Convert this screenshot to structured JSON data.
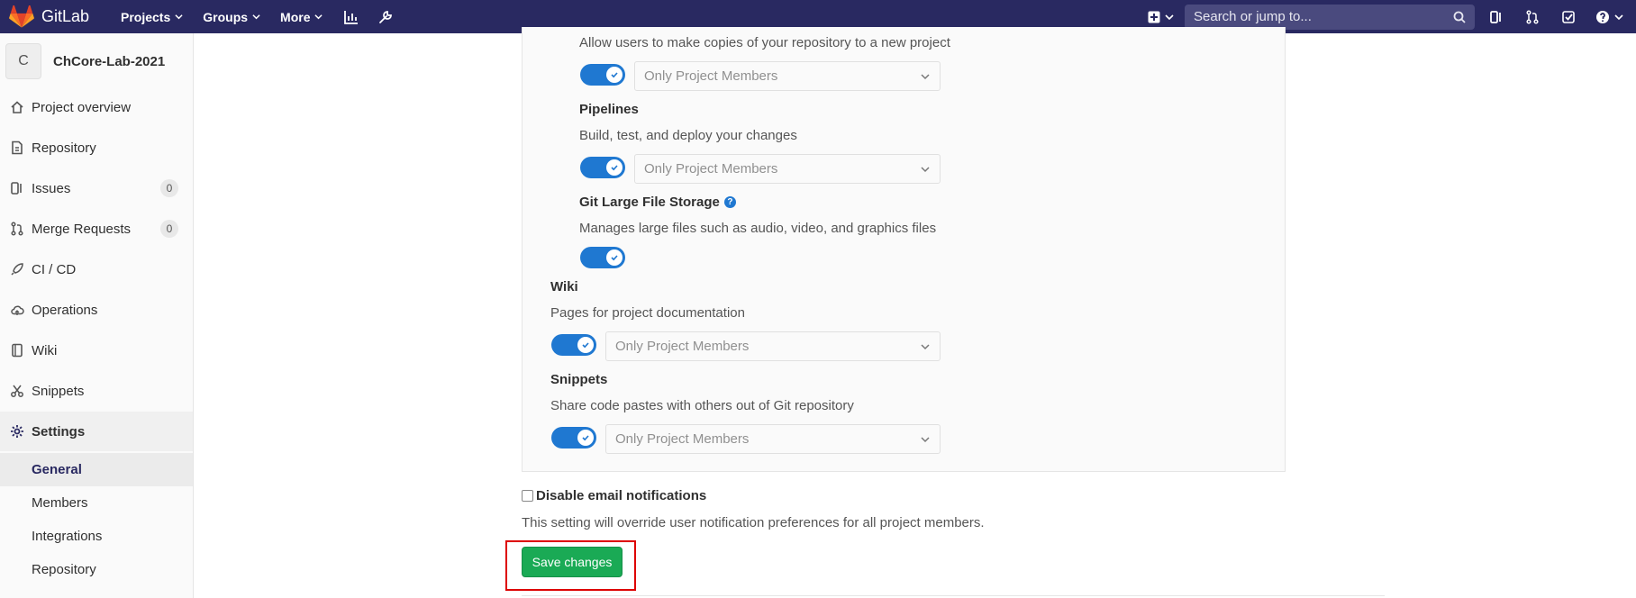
{
  "navbar": {
    "brand": "GitLab",
    "menu": [
      "Projects",
      "Groups",
      "More"
    ],
    "search_placeholder": "Search or jump to..."
  },
  "sidebar": {
    "project_initial": "C",
    "project_name": "ChCore-Lab-2021",
    "items": [
      {
        "label": "Project overview",
        "icon": "home-icon"
      },
      {
        "label": "Repository",
        "icon": "doc-icon"
      },
      {
        "label": "Issues",
        "icon": "issues-icon",
        "badge": "0"
      },
      {
        "label": "Merge Requests",
        "icon": "merge-request-icon",
        "badge": "0"
      },
      {
        "label": "CI / CD",
        "icon": "rocket-icon"
      },
      {
        "label": "Operations",
        "icon": "cloud-icon"
      },
      {
        "label": "Wiki",
        "icon": "book-icon"
      },
      {
        "label": "Snippets",
        "icon": "scissors-icon"
      },
      {
        "label": "Settings",
        "icon": "gear-icon"
      }
    ],
    "subitems": [
      "General",
      "Members",
      "Integrations",
      "Repository"
    ]
  },
  "content": {
    "forks_desc": "Allow users to make copies of your repository to a new project",
    "forks_access": "Only Project Members",
    "pipelines_title": "Pipelines",
    "pipelines_desc": "Build, test, and deploy your changes",
    "pipelines_access": "Only Project Members",
    "lfs_title": "Git Large File Storage",
    "lfs_help": "?",
    "lfs_desc": "Manages large files such as audio, video, and graphics files",
    "wiki_title": "Wiki",
    "wiki_desc": "Pages for project documentation",
    "wiki_access": "Only Project Members",
    "snippets_title": "Snippets",
    "snippets_desc": "Share code pastes with others out of Git repository",
    "snippets_access": "Only Project Members",
    "email_label": "Disable email notifications",
    "email_note": "This setting will override user notification preferences for all project members.",
    "save_label": "Save changes"
  },
  "colors": {
    "navbar": "#292961",
    "toggle": "#1f78d1",
    "save": "#1aaa55",
    "highlight": "#dd0000"
  }
}
